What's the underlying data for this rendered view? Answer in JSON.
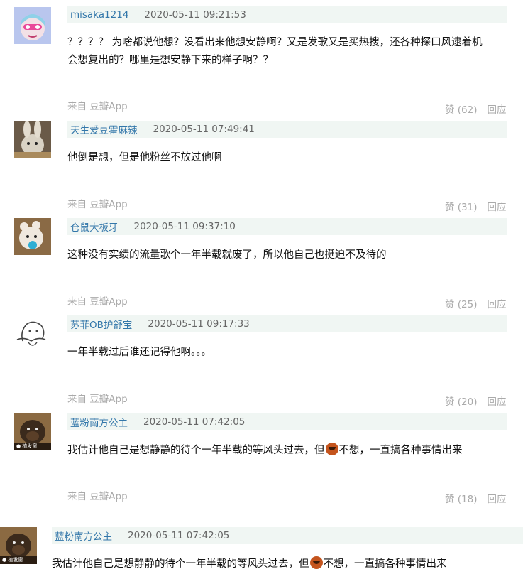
{
  "source_label": "来自 豆瓣App",
  "reply_label": "回应",
  "comments": [
    {
      "username": "misaka1214",
      "time": "2020-05-11 09:21:53",
      "text_line1": "？？？？ 为啥都说他想？没看出来他想安静啊？又是发歌又是买热搜，还各种探口风逮着机",
      "text_line2": "会想复出的？哪里是想安静下来的样子啊？？",
      "likes": "赞 (62)"
    },
    {
      "username": "天生爱豆霍麻辣",
      "time": "2020-05-11 07:49:41",
      "text": "他倒是想，但是他粉丝不放过他啊",
      "likes": "赞 (31)"
    },
    {
      "username": "仓鼠大板牙",
      "time": "2020-05-11 09:37:10",
      "text": "这种没有实绩的流量歌个一年半载就废了，所以他自己也挺迫不及待的",
      "likes": "赞 (25)"
    },
    {
      "username": "苏菲OB护舒宝",
      "time": "2020-05-11 09:17:33",
      "text": "一年半载过后谁还记得他啊。。。",
      "likes": "赞 (20)"
    },
    {
      "username": "蓝粉南方公主",
      "time": "2020-05-11 07:42:05",
      "text_before": "我估计他自己是想静静的待个一年半载的等风头过去，但",
      "text_after": "不想，一直搞各种事情出来",
      "likes": "赞 (18)",
      "avatar_caption": "● 植发窗"
    },
    {
      "username": "蓝粉南方公主",
      "time": "2020-05-11 07:42:05",
      "text_before": "我估计他自己是想静静的待个一年半载的等风头过去，但",
      "text_after": "不想，一直搞各种事情出来",
      "avatar_caption": "● 植发窗"
    }
  ]
}
